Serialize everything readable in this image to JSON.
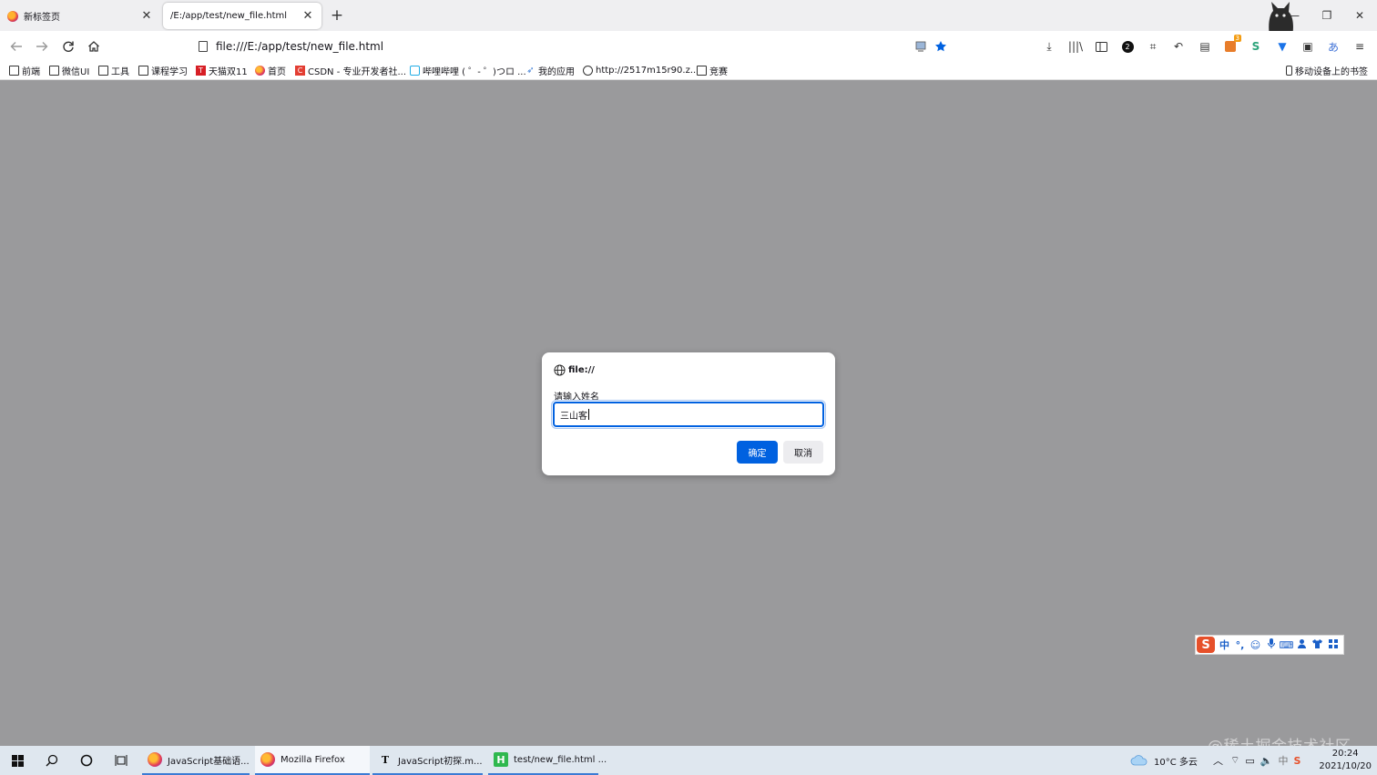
{
  "browser": {
    "tabs": [
      {
        "label": "新标签页",
        "active": false
      },
      {
        "label": "/E:/app/test/new_file.html",
        "active": true
      }
    ],
    "new_tab_symbol": "+",
    "window_controls": {
      "minimize": "—",
      "restore": "❐",
      "close": "✕"
    },
    "url": "file:///E:/app/test/new_file.html",
    "toolbar_badges": {
      "extension_count": "2",
      "notification_count": "3"
    },
    "bookmarks": [
      {
        "label": "前端",
        "icon": "folder-icon"
      },
      {
        "label": "微信UI",
        "icon": "folder-icon"
      },
      {
        "label": "工具",
        "icon": "folder-icon"
      },
      {
        "label": "课程学习",
        "icon": "folder-icon"
      },
      {
        "label": "天猫双11",
        "icon": "tmall-icon",
        "icon_text": "T"
      },
      {
        "label": "首页",
        "icon": "firefox-icon"
      },
      {
        "label": "CSDN - 专业开发者社...",
        "icon": "csdn-icon",
        "icon_text": "C"
      },
      {
        "label": "哔哩哔哩 ( ゜- ゜)つロ ...",
        "icon": "bilibili-icon"
      },
      {
        "label": "我的应用",
        "icon": "rocket-icon"
      },
      {
        "label": "http://2517m15r90.z...",
        "icon": "globe-icon"
      },
      {
        "label": "竞赛",
        "icon": "folder-icon"
      }
    ],
    "mobile_bookmarks": "移动设备上的书签"
  },
  "dialog": {
    "origin": "file://",
    "message": "请输入姓名",
    "input_value": "三山客",
    "ok_label": "确定",
    "cancel_label": "取消"
  },
  "ime": {
    "logo": "S",
    "mode": "中",
    "punct": "°,",
    "icons": [
      "☺",
      "🎤",
      "⌨",
      "👥",
      "👕",
      "▦"
    ]
  },
  "watermark": "@稀土掘金技术社区",
  "taskbar": {
    "tasks": [
      {
        "label": "JavaScript基础语...",
        "icon": "firefox-icon",
        "active": false
      },
      {
        "label": "Mozilla Firefox",
        "icon": "firefox-icon",
        "active": true
      },
      {
        "label": "JavaScript初探.m...",
        "icon": "typora-icon",
        "icon_text": "T",
        "active": false
      },
      {
        "label": "test/new_file.html ...",
        "icon": "hbuilder-icon",
        "icon_text": "H",
        "active": false
      }
    ],
    "weather": "10°C 多云",
    "time": "20:24",
    "date": "2021/10/20"
  },
  "colors": {
    "accent": "#0061e0",
    "overlay": "#9a9a9c",
    "taskbar": "#dfe7ef"
  }
}
